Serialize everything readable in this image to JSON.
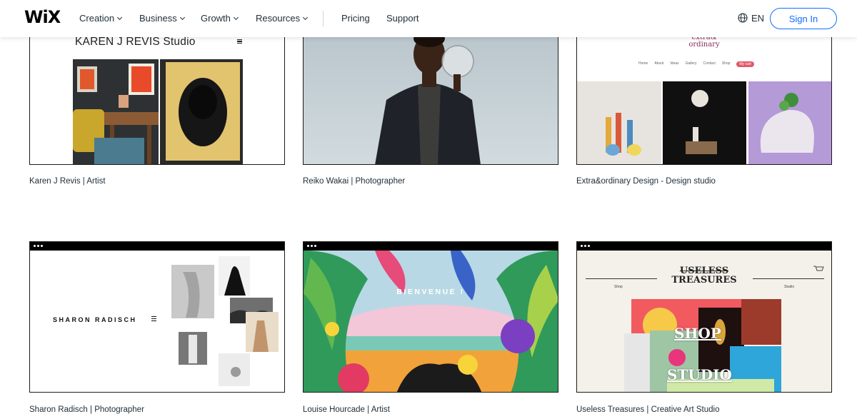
{
  "nav": {
    "logo": "WiX",
    "items": [
      {
        "label": "Creation",
        "dropdown": true
      },
      {
        "label": "Business",
        "dropdown": true
      },
      {
        "label": "Growth",
        "dropdown": true
      },
      {
        "label": "Resources",
        "dropdown": true
      },
      {
        "label": "Pricing",
        "dropdown": false
      },
      {
        "label": "Support",
        "dropdown": false
      }
    ],
    "language": "EN",
    "sign_in": "Sign In"
  },
  "templates": [
    {
      "caption": "Karen J Revis | Artist",
      "site_title": "KAREN J REVIS Studio"
    },
    {
      "caption": "Reiko Wakai | Photographer"
    },
    {
      "caption": "Extra&ordinary Design - Design studio",
      "site_logo": "extra&\nordinary",
      "site_menu": [
        "Home",
        "About",
        "Ideas",
        "Gallery",
        "Contact",
        "Shop",
        "My cart"
      ]
    },
    {
      "caption": "Sharon Radisch | Photographer",
      "site_title": "SHARON RADISCH"
    },
    {
      "caption": "Louise Hourcade | Artist",
      "site_title": "BIENVENUE !"
    },
    {
      "caption": "Useless Treasures | Creative Art Studio",
      "site_title_1": "USELESS",
      "site_title_2": "TREASURES",
      "site_left": "Shop",
      "site_right": "Studio",
      "overlay_1": "SHOP",
      "overlay_2": "STUDIO"
    }
  ],
  "colors": {
    "accent": "#116dff",
    "text": "#20303c"
  }
}
